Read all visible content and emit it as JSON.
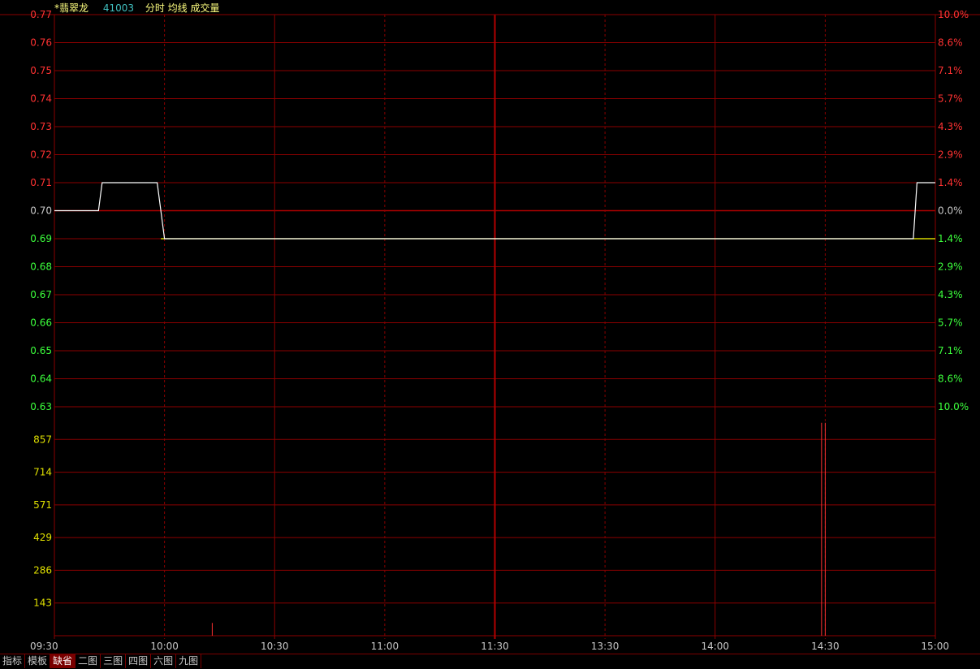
{
  "title": {
    "stock_name": "*翡翠龙",
    "stock_code": "41003",
    "indicators": "分时 均线 成交量"
  },
  "tabs": [
    {
      "label": "指标",
      "active": false
    },
    {
      "label": "模板",
      "active": false
    },
    {
      "label": "缺省",
      "active": true
    },
    {
      "label": "二图",
      "active": false
    },
    {
      "label": "三图",
      "active": false
    },
    {
      "label": "四图",
      "active": false
    },
    {
      "label": "六图",
      "active": false
    },
    {
      "label": "九图",
      "active": false
    }
  ],
  "colors": {
    "background": "#000000",
    "grid": "#8b0000",
    "grid_major": "#b00000",
    "up": "#ff3232",
    "down": "#3cff3c",
    "neutral": "#c8c8c8",
    "price_line": "#ffffff",
    "avg_line": "#ffff00",
    "volume_label": "#e0e000",
    "time_label": "#c8c8c8"
  },
  "chart_data": [
    {
      "type": "line",
      "name": "intraday-price",
      "x_labels": [
        "09:30",
        "10:00",
        "10:30",
        "11:00",
        "11:30",
        "13:30",
        "14:00",
        "14:30",
        "15:00"
      ],
      "y_ticks": [
        "0.77",
        "0.76",
        "0.75",
        "0.74",
        "0.73",
        "0.72",
        "0.71",
        "0.70",
        "0.69",
        "0.68",
        "0.67",
        "0.66",
        "0.65",
        "0.64",
        "0.63"
      ],
      "y_right_ticks": [
        "10.0%",
        "8.6%",
        "7.1%",
        "5.7%",
        "4.3%",
        "2.9%",
        "1.4%",
        "0.0%",
        "1.4%",
        "2.9%",
        "4.3%",
        "5.7%",
        "7.1%",
        "8.6%",
        "10.0%"
      ],
      "prev_close": 0.7,
      "ylim": [
        0.63,
        0.77
      ],
      "series": [
        {
          "points": [
            [
              "09:30",
              0.7
            ],
            [
              "09:42",
              0.7
            ],
            [
              "09:43",
              0.71
            ],
            [
              "09:58",
              0.71
            ],
            [
              "09:59",
              0.69
            ],
            [
              "15:00",
              0.69
            ]
          ],
          "segments": [
            [
              [
                "09:30",
                0.7
              ],
              [
                "09:42",
                0.7
              ],
              [
                "09:43",
                0.71
              ],
              [
                "09:58",
                0.71
              ],
              [
                "10:00",
                0.69
              ],
              [
                "14:54",
                0.69
              ],
              [
                "14:55",
                0.71
              ],
              [
                "15:00",
                0.71
              ]
            ]
          ]
        },
        {
          "points": [
            [
              "09:59",
              0.69
            ],
            [
              "10:12",
              0.69
            ],
            [
              "15:00",
              0.69
            ]
          ]
        }
      ]
    },
    {
      "type": "bar",
      "name": "volume",
      "y_ticks": [
        "857",
        "714",
        "571",
        "429",
        "286",
        "143"
      ],
      "ylim": [
        0,
        1000
      ],
      "bars": [
        [
          "10:13",
          60
        ],
        [
          "14:29",
          1000
        ],
        [
          "14:30",
          1000
        ]
      ]
    }
  ]
}
